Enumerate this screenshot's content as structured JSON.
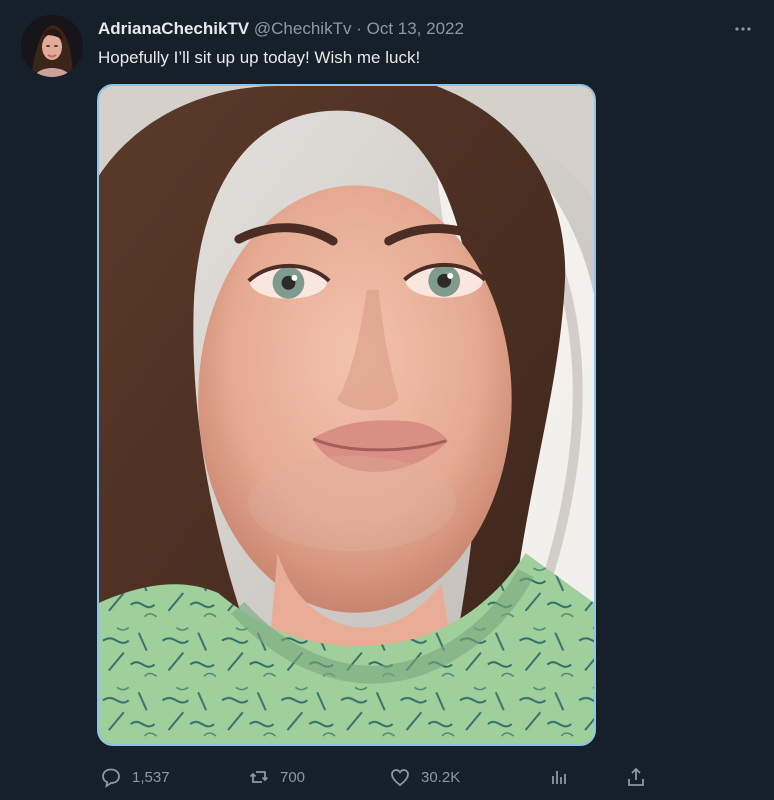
{
  "tweet": {
    "author": {
      "display_name": "AdrianaChechikTV",
      "handle": "@ChechikTv"
    },
    "date": "Oct 13, 2022",
    "separator": "·",
    "text": "Hopefully I’ll sit up up today! Wish me luck!",
    "more_icon": "more-icon"
  },
  "actions": {
    "replies": "1,537",
    "retweets": "700",
    "likes": "30.2K"
  },
  "colors": {
    "background": "#15202b",
    "text": "#e7e9ea",
    "secondary_text": "#8b98a5",
    "media_outline": "#8ec4e8"
  },
  "icons": {
    "reply": "reply-icon",
    "retweet": "retweet-icon",
    "like": "heart-icon",
    "analytics": "analytics-icon",
    "share": "share-icon"
  }
}
